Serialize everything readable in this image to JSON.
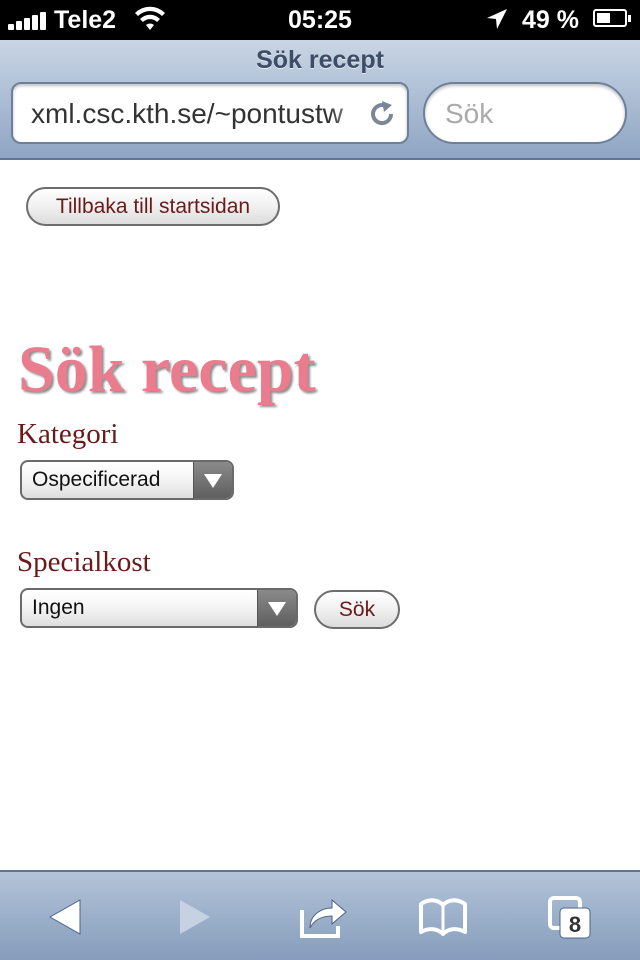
{
  "status_bar": {
    "carrier": "Tele2",
    "time": "05:25",
    "battery_percent_label": "49 %",
    "battery_level": 0.49
  },
  "browser": {
    "page_title": "Sök recept",
    "url": "xml.csc.kth.se/~pontustw",
    "search_placeholder": "Sök",
    "tab_count": "8"
  },
  "page": {
    "back_button": "Tillbaka till startsidan",
    "heading": "Sök recept",
    "category_label": "Kategori",
    "category_selected": "Ospecificerad",
    "diet_label": "Specialkost",
    "diet_selected": "Ingen",
    "search_button": "Sök"
  },
  "icons": {
    "signal": "signal-bars-icon",
    "wifi": "wifi-icon",
    "location": "location-arrow-icon",
    "battery": "battery-icon",
    "reload": "reload-icon",
    "back": "back-arrow-icon",
    "forward": "forward-arrow-icon",
    "share": "share-icon",
    "bookmarks": "bookmarks-icon",
    "tabs": "tabs-icon"
  },
  "colors": {
    "heading": "#ea7c8d",
    "label_text": "#6b1a1a",
    "chrome": "#a9bbd2"
  }
}
